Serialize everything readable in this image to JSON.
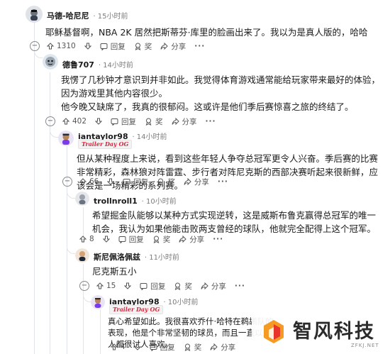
{
  "comments": [
    {
      "user": "马德-哈尼尼",
      "time": "· 15小时前",
      "body": "耶稣基督啊，NBA 2K 居然把斯蒂芬·库里的脸画出来了。我以为是真人版的，哈哈",
      "votes": "1310",
      "reply": "回复",
      "award": "奖",
      "share": "分享"
    },
    {
      "user": "德鲁707",
      "time": "· 14小时前",
      "body": "我愣了几秒钟才意识到并非如此。我觉得体育游戏通常能给玩家带来最好的体验，因为游戏里其他内容很少。",
      "body2": "他今晚又缺席了，我真的很郁闷。这或许是他们季后赛惊喜之旅的终结了。",
      "votes": "402",
      "reply": "回复",
      "award": "奖",
      "share": "分享"
    },
    {
      "user": "iantaylor98",
      "time": "· 14小时前",
      "flair": "Trailer Day OG",
      "body": "但从某种程度上来说，看到这些年轻人争夺总冠军更令人兴奋。季后赛的比赛非常精彩，森林狼对阵雷霆、步行者对阵尼克斯的西部决赛听起来很新鲜，应该会是一场精彩的系列赛。",
      "votes": "66",
      "reply": "回复",
      "award": "奖",
      "share": "分享"
    },
    {
      "user": "trollnroll1",
      "time": "· 10小时前",
      "body": "希望掘金队能够以某种方式实现逆转，这是威斯布鲁克赢得总冠军的唯一机会，我认为如果他能击败两支曾经的球队，他就完全配得上这个冠军。",
      "votes": "8",
      "reply": "回复",
      "award": "奖",
      "share": "分享"
    },
    {
      "user": "斯尼佩洛佩兹",
      "time": "· 11小时前",
      "body": "尼克斯五小",
      "votes": "15",
      "reply": "回复",
      "award": "奖",
      "share": "分享"
    },
    {
      "user": "iantaylor98",
      "time": "· 10小时前",
      "flair": "Trailer Day OG",
      "body": "真心希望如此。我很喜欢乔什·哈特在鹈鹕队的表现，他是个非常坚韧的球员，而且一直以来人都很讨人喜欢。",
      "votes": "4",
      "reply": "回复",
      "award": "奖",
      "share": "分享"
    }
  ],
  "watermark": {
    "text": "智风科技",
    "sub": "ZFKJ.NET"
  },
  "colors": {
    "flair_text": "#d7263d",
    "thread_line": "#e1e4e8",
    "logo_red": "#e8352c",
    "logo_orange": "#f59b23"
  }
}
